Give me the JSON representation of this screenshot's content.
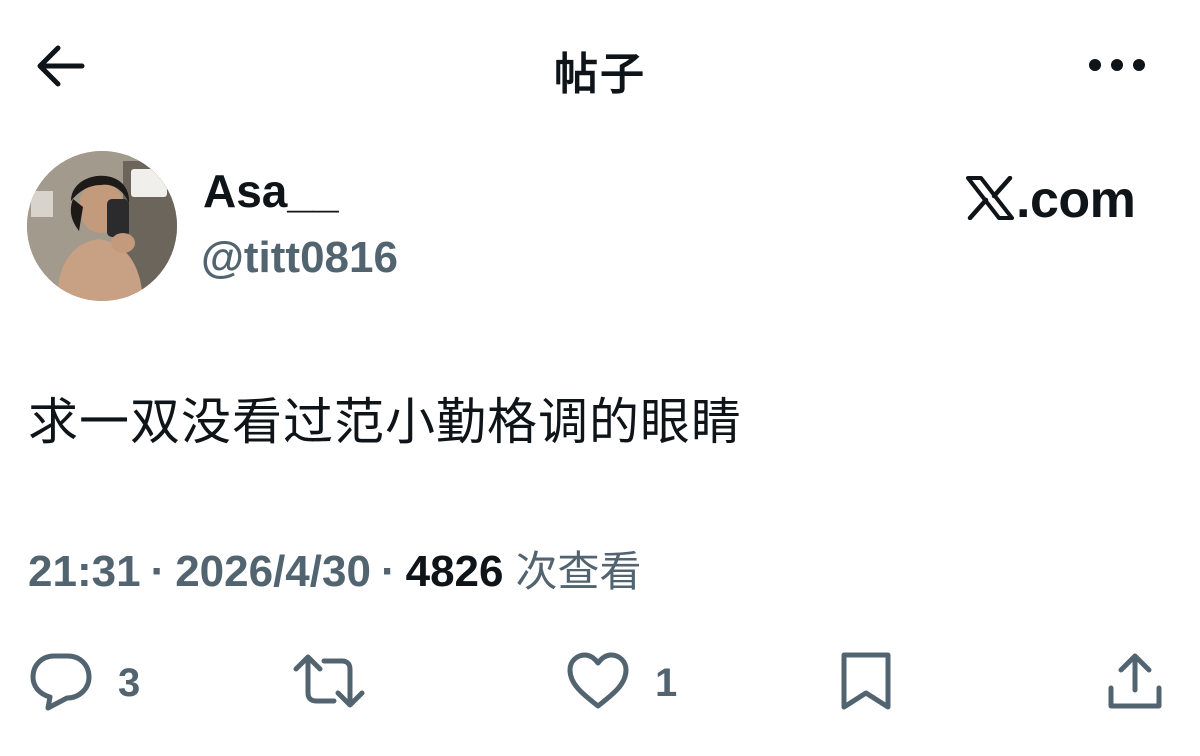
{
  "header": {
    "title": "帖子",
    "back_icon": "arrow-left-icon",
    "more_icon": "more-horizontal-icon"
  },
  "author": {
    "display_name": "Asa__",
    "handle": "@titt0816",
    "avatar_icon": "user-avatar"
  },
  "brand": {
    "text": ".com",
    "logo_icon": "x-logo-icon"
  },
  "post": {
    "text": "求一双没看过范小勤格调的眼睛"
  },
  "meta": {
    "time": "21:31",
    "date": "2026/4/30",
    "views_count": "4826",
    "views_label": "次查看"
  },
  "actions": {
    "reply_count": "3",
    "like_count": "1"
  },
  "colors": {
    "text": "#0f1419",
    "muted": "#536471",
    "background": "#ffffff"
  }
}
